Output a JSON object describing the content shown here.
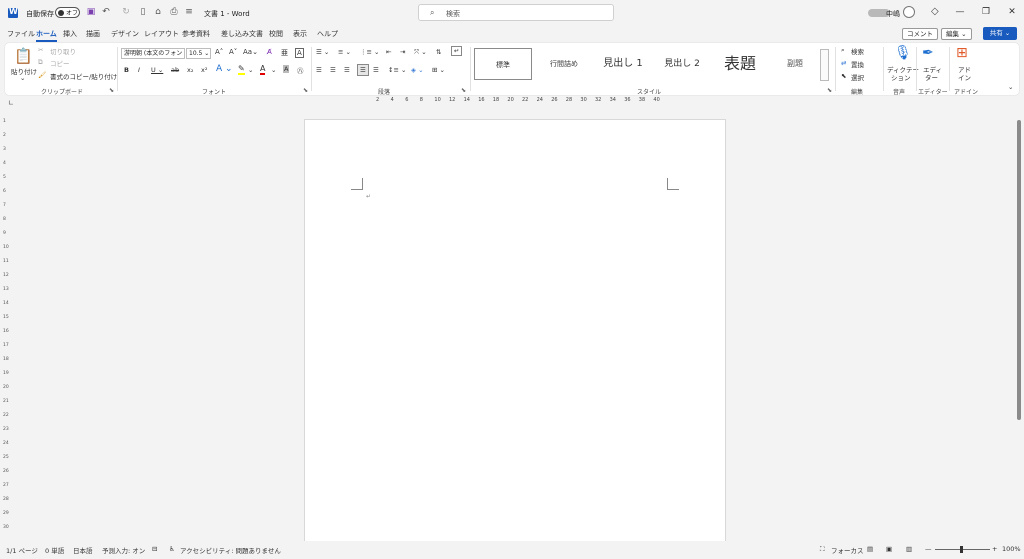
{
  "titlebar": {
    "autosave_label": "自動保存",
    "autosave_state": "オフ",
    "document_title": "文書 1  -  Word",
    "search_placeholder": "検索",
    "user_name": "中嶋",
    "minimize": "—",
    "restore": "❐",
    "close": "✕"
  },
  "tabs": [
    "ファイル",
    "ホーム",
    "挿入",
    "描画",
    "デザイン",
    "レイアウト",
    "参考資料",
    "差し込み文書",
    "校閲",
    "表示",
    "ヘルプ"
  ],
  "active_tab": "ホーム",
  "top_right": {
    "comments": "コメント",
    "editing": "編集",
    "share": "共有"
  },
  "clipboard": {
    "paste": "貼り付け",
    "cut": "切り取り",
    "copy": "コピー",
    "format_painter": "書式のコピー/貼り付け",
    "label": "クリップボード"
  },
  "font": {
    "font_name": "游明朝 (本文のフォン",
    "font_size": "10.5",
    "label": "フォント",
    "case_label": "Aa"
  },
  "paragraph": {
    "label": "段落"
  },
  "styles": {
    "label": "スタイル",
    "items": [
      "標準",
      "行間詰め",
      "見出し 1",
      "見出し 2",
      "表題",
      "副題"
    ]
  },
  "editing": {
    "label": "編集",
    "find": "検索",
    "replace": "置換",
    "select": "選択"
  },
  "voice": {
    "dictate": "ディクテー",
    "dictate2": "ション",
    "label": "音声"
  },
  "editor": {
    "name": "エディ",
    "name2": "ター",
    "label": "エディター"
  },
  "addins": {
    "name": "アド",
    "name2": "イン",
    "label": "アドイン"
  },
  "ruler_numbers": [
    "2",
    "4",
    "6",
    "8",
    "10",
    "12",
    "14",
    "16",
    "18",
    "20",
    "22",
    "24",
    "26",
    "28",
    "30",
    "32",
    "34",
    "36",
    "38",
    "40"
  ],
  "vruler_numbers": [
    "1",
    "2",
    "3",
    "4",
    "5",
    "6",
    "7",
    "8",
    "9",
    "10",
    "11",
    "12",
    "13",
    "14",
    "15",
    "16",
    "17",
    "18",
    "19",
    "20",
    "21",
    "22",
    "23",
    "24",
    "25",
    "26",
    "27",
    "28",
    "29",
    "30"
  ],
  "statusbar": {
    "page": "1/1 ページ",
    "words": "0 単語",
    "language": "日本語",
    "ime": "予測入力: オン",
    "accessibility": "アクセシビリティ: 問題ありません",
    "focus": "フォーカス",
    "zoom": "100%"
  },
  "colors": {
    "accent": "#185abd",
    "highlight": "#ffff00",
    "font_color": "#e00000"
  }
}
